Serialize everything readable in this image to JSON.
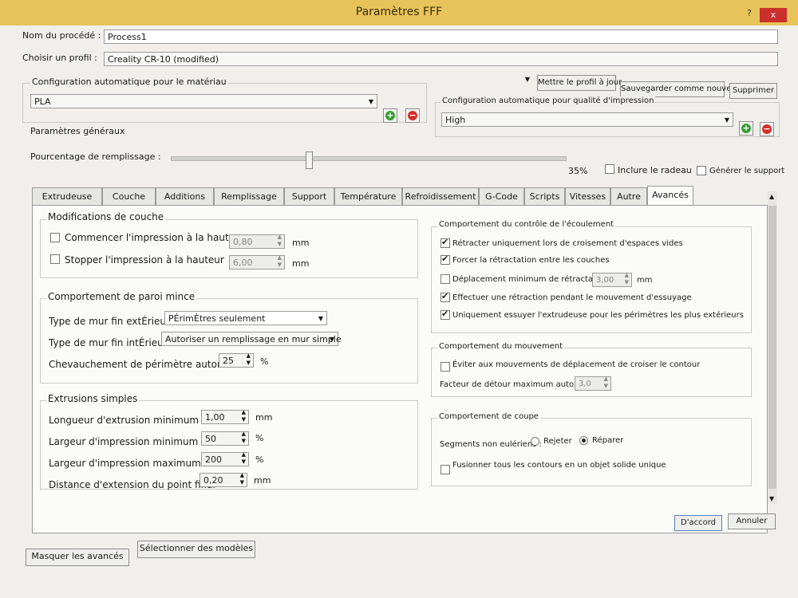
{
  "window": {
    "title": "Paramètres FFF",
    "help": "?",
    "close": "x"
  },
  "header": {
    "process_label": "Nom du procédé :",
    "process_value": "Process1",
    "profile_label": "Choisir un profil :",
    "profile_value": "Creality CR-10 (modified)",
    "update_profile": "Mettre le profil à jour",
    "save_as_new": "Sauvegarder comme nouveau",
    "delete": "Supprimer",
    "material_label": "Configuration automatique pour le matériau",
    "material_value": "PLA",
    "quality_label": "Configuration automatique pour qualité d'impression",
    "quality_value": "High",
    "general_label": "Paramètres généraux",
    "infill_label": "Pourcentage de remplissage :",
    "infill_value": "35%",
    "infill_fraction": 0.35,
    "raft_label": "Inclure le radeau",
    "support_label": "Générer le support"
  },
  "tabs": [
    "Extrudeuse",
    "Couche",
    "Additions",
    "Remplissage",
    "Support",
    "Température",
    "Refroidissement",
    "G-Code",
    "Scripts",
    "Vitesses",
    "Autre",
    "Avancés"
  ],
  "active_tab": "Avancés",
  "left": {
    "layer_mod": {
      "title": "Modifications de couche",
      "start_label": "Commencer l'impression à la hauteur",
      "start_value": "0,80",
      "stop_label": "Stopper  l'impression à la hauteur",
      "stop_value": "6,00",
      "unit": "mm"
    },
    "thin_wall": {
      "title": "Comportement de paroi mince",
      "outer_label": "Type de mur fin extÉrieur",
      "outer_value": "PÉrimÈtres seulement",
      "inner_label": "Type de mur fin intÉrieur",
      "inner_value": "Autoriser un remplissage en mur simple",
      "overlap_label": "Chevauchement de périmètre autorisé",
      "overlap_value": "25",
      "overlap_unit": "%"
    },
    "simple": {
      "title": "Extrusions simples",
      "min_len_label": "Longueur d'extrusion minimum",
      "min_len_value": "1,00",
      "min_len_unit": "mm",
      "min_w_label": "Largeur d'impression minimum",
      "min_w_value": "50",
      "min_w_unit": "%",
      "max_w_label": "Largeur d'impression maximum",
      "max_w_value": "200",
      "max_w_unit": "%",
      "ext_label": "Distance d'extension du point final",
      "ext_value": "0,20",
      "ext_unit": "mm"
    }
  },
  "right": {
    "flow": {
      "title": "Comportement du contrôle de l'écoulement",
      "retract_only": "Rétracter uniquement lors de croisement d'espaces vides",
      "force_retract": "Forcer la rétractation entre les couches",
      "min_travel": "Déplacement minimum de rétractation",
      "min_travel_value": "3,00",
      "min_travel_unit": "mm",
      "wipe": "Effectuer une rétraction pendant le mouvement d'essuyage",
      "wipe_outer": "Uniquement essuyer l'extrudeuse pour les périmètres les plus extérieurs"
    },
    "motion": {
      "title": "Comportement du mouvement",
      "avoid": "Éviter aux mouvements de déplacement de croiser le contour",
      "detour_label": "Facteur de détour maximum autorisé",
      "detour_value": "3,0"
    },
    "cut": {
      "title": "Comportement de coupe",
      "nonmanifold_label": "Segments non eulériens :",
      "reject": "Rejeter",
      "repair": "Réparer",
      "merge": "Fusionner tous les contours en un objet solide unique"
    }
  },
  "footer": {
    "ok": "D'accord",
    "cancel": "Annuler",
    "hide_advanced": "Masquer les avancés",
    "select_models": "Sélectionner des modèles"
  }
}
